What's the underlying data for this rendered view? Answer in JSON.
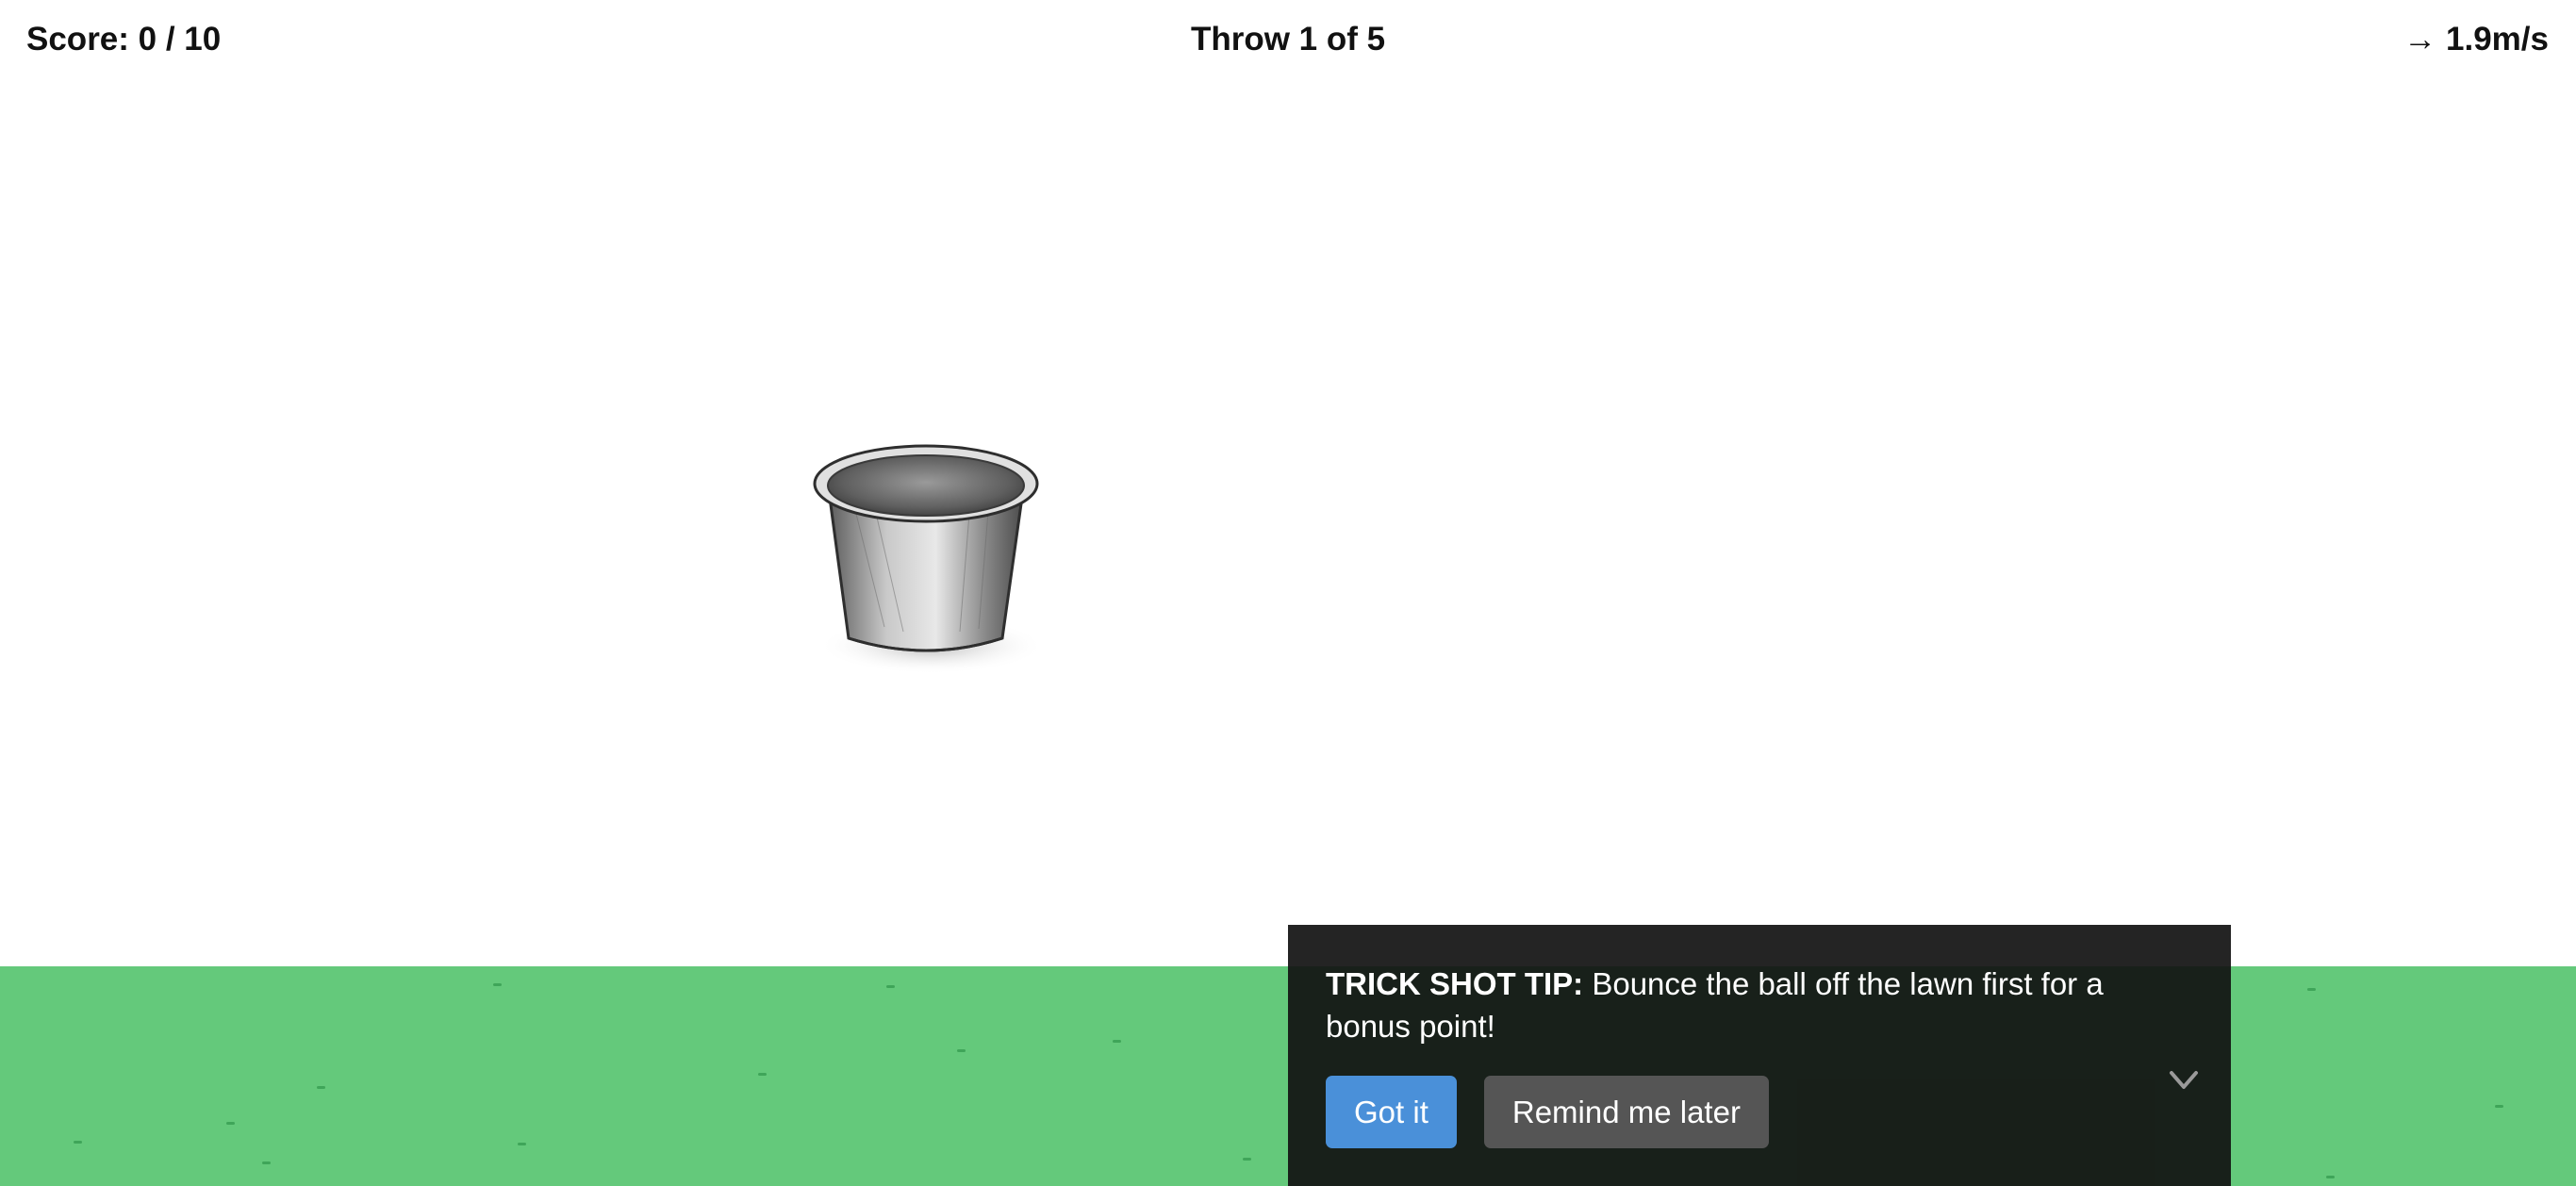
{
  "hud": {
    "score_label": "Score: 0 / 10",
    "throw_label": "Throw 1 of 5",
    "wind_label": "→ 1.9m/s"
  },
  "tip": {
    "heading": "TRICK SHOT TIP:",
    "body": " Bounce the ball off the lawn first for a bonus point!",
    "primary_label": "Got it",
    "secondary_label": "Remind me later"
  },
  "icons": {
    "collapse": "chevron-down-icon",
    "target": "bucket-icon"
  },
  "colors": {
    "lawn": "#64c97b",
    "tip_background": "#111111",
    "primary_button": "#4a90d9",
    "secondary_button": "#555555"
  }
}
